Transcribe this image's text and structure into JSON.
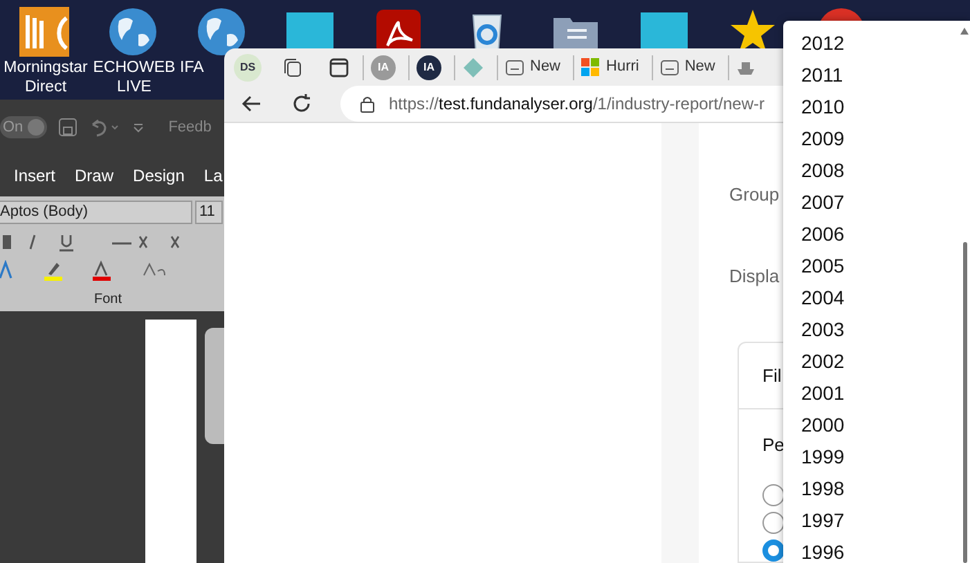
{
  "desktop_icons": [
    {
      "kind": "morningstar",
      "label": "Morningstar Direct"
    },
    {
      "kind": "globe",
      "label": "ECHOWEB LIVE"
    },
    {
      "kind": "globe",
      "label": "IFA"
    },
    {
      "kind": "teal"
    },
    {
      "kind": "pdf"
    },
    {
      "kind": "recycle"
    },
    {
      "kind": "folder"
    },
    {
      "kind": "teal"
    },
    {
      "kind": "star"
    },
    {
      "kind": "red"
    }
  ],
  "word": {
    "toggle": "On",
    "title": "Feedb",
    "ribbon_tabs": [
      "Insert",
      "Draw",
      "Design",
      "La"
    ],
    "font_name": "Aptos (Body)",
    "font_size": "11",
    "group_label": "Font"
  },
  "browser": {
    "profile": "DS",
    "tabs": [
      {
        "kind": "avatar-grey",
        "label": "IA"
      },
      {
        "kind": "avatar-dark",
        "label": "IA"
      },
      {
        "kind": "diamond"
      },
      {
        "kind": "page",
        "label": "New"
      },
      {
        "kind": "ms",
        "label": "Hurri"
      },
      {
        "kind": "page",
        "label": "New"
      },
      {
        "kind": "ship"
      }
    ],
    "url": {
      "scheme": "https://",
      "host": "test.fundanalyser.org",
      "path": "/1/industry-report/new-r"
    },
    "page": {
      "labels": [
        "Group",
        "Displa"
      ],
      "card_title": "Fil",
      "section_label": "Pe",
      "radios": [
        {
          "selected": false
        },
        {
          "selected": false
        },
        {
          "selected": true
        }
      ]
    }
  },
  "dropdown": {
    "options": [
      "2012",
      "2011",
      "2010",
      "2009",
      "2008",
      "2007",
      "2006",
      "2005",
      "2004",
      "2003",
      "2002",
      "2001",
      "2000",
      "1999",
      "1998",
      "1997",
      "1996"
    ]
  }
}
